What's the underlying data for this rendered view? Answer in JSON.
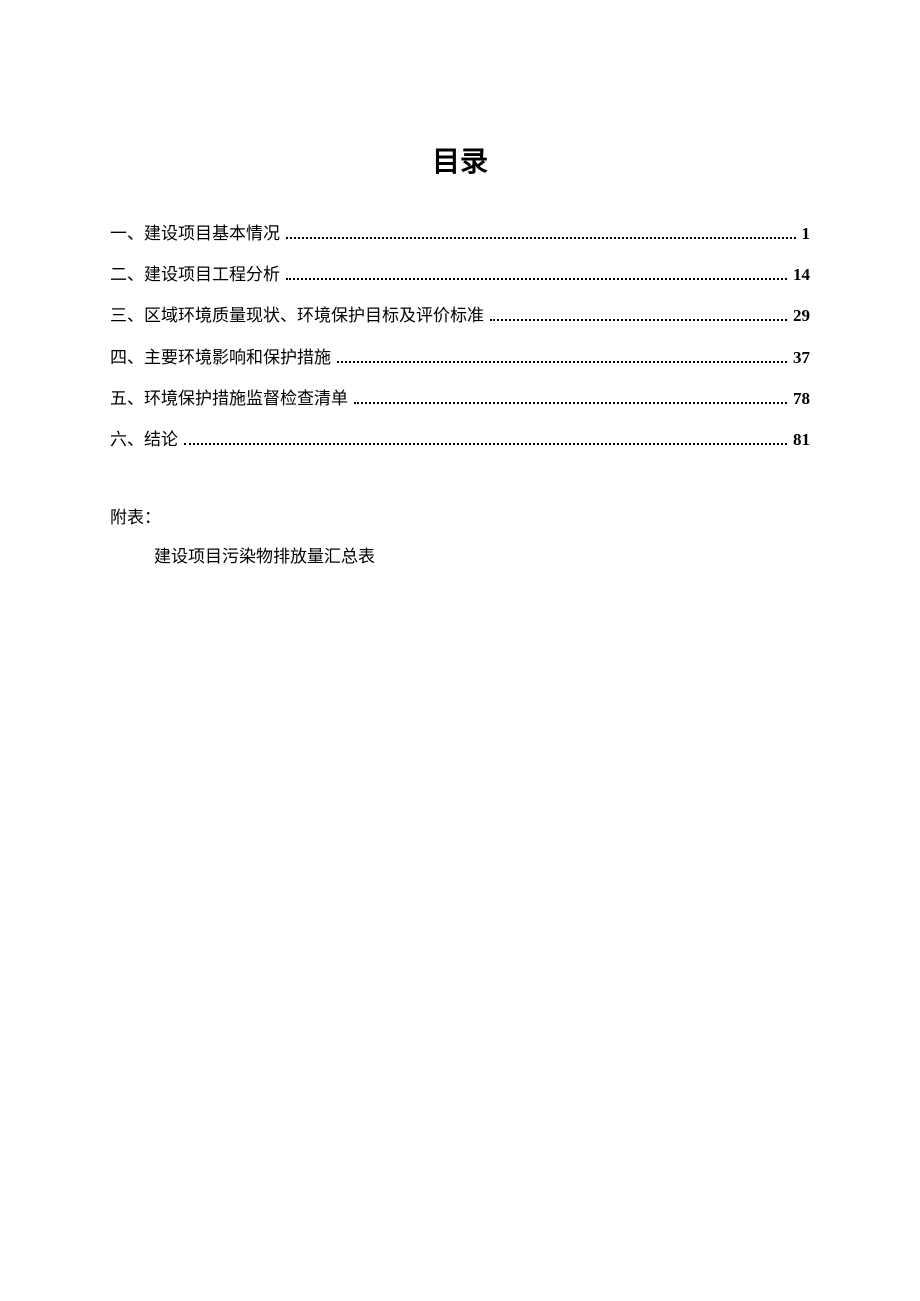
{
  "title": "目录",
  "toc": {
    "entries": [
      {
        "label": "一、建设项目基本情况",
        "page": "1"
      },
      {
        "label": "二、建设项目工程分析",
        "page": "14"
      },
      {
        "label": "三、区域环境质量现状、环境保护目标及评价标准",
        "page": "29"
      },
      {
        "label": "四、主要环境影响和保护措施",
        "page": "37"
      },
      {
        "label": "五、环境保护措施监督检查清单",
        "page": "78"
      },
      {
        "label": "六、结论",
        "page": "81"
      }
    ]
  },
  "appendix": {
    "heading": "附表：",
    "item": "建设项目污染物排放量汇总表"
  }
}
